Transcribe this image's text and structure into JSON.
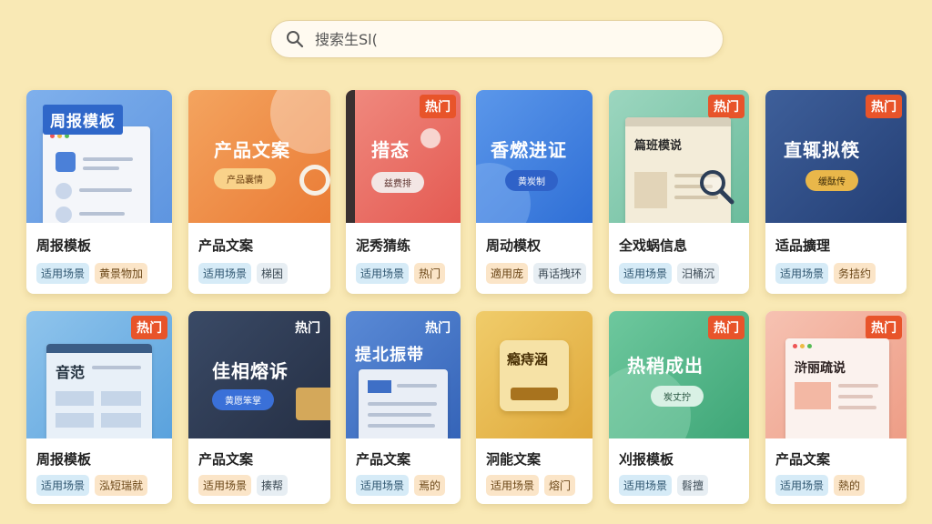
{
  "search": {
    "placeholder": "搜索生Sl("
  },
  "cards": [
    {
      "thumb_title": "周报模板",
      "hot": "",
      "pill": "",
      "name": "周报模板",
      "tags": [
        "适用场景",
        "黄景物加"
      ],
      "bg": "#5e95e0"
    },
    {
      "thumb_title": "产品文案",
      "hot": "",
      "pill": "产品囊情",
      "name": "产品文案",
      "tags": [
        "适用场景",
        "梯困"
      ],
      "bg": "#ef8c47"
    },
    {
      "thumb_title": "措态",
      "hot": "热门",
      "pill": "兹费排",
      "name": "泥秀猜练",
      "tags": [
        "适用场景",
        "热门"
      ],
      "bg": "#ea6a5f"
    },
    {
      "thumb_title": "香燃进证",
      "hot": "",
      "pill": "黄炭制",
      "name": "周动模权",
      "tags": [
        "適用庞",
        "再话拽环"
      ],
      "bg": "#3d7de0"
    },
    {
      "thumb_title": "篇班模说",
      "hot": "热门",
      "pill": "",
      "name": "全戏蜗信息",
      "tags": [
        "适用场景",
        "汨桶沉"
      ],
      "bg": "#7cc4a8"
    },
    {
      "thumb_title": "直辄拟筷",
      "hot": "热门",
      "pill": "缓酞传",
      "name": "适品擴理",
      "tags": [
        "适用场景",
        "务拮约"
      ],
      "bg": "#2f4f88"
    },
    {
      "thumb_title": "音范",
      "hot": "热门",
      "pill": "",
      "name": "周报模板",
      "tags": [
        "适用场景",
        "泓短瑞就"
      ],
      "bg": "#6aaee0"
    },
    {
      "thumb_title": "佳相熔诉",
      "hot": "热门",
      "pill": "黄愿笨掌",
      "name": "产品文案",
      "tags": [
        "适用场景",
        "揍帮"
      ],
      "bg": "#2e3d57"
    },
    {
      "thumb_title": "提北振带",
      "hot": "热门",
      "pill": "",
      "name": "产品文案",
      "tags": [
        "适用场景",
        "焉的"
      ],
      "bg": "#3f6fc4"
    },
    {
      "thumb_title": "瘾痔涵",
      "hot": "",
      "pill": "",
      "name": "泂能文案",
      "tags": [
        "适用场景",
        "熔门"
      ],
      "bg": "#e7b84a"
    },
    {
      "thumb_title": "热稍成出",
      "hot": "热门",
      "pill": "炭丈拧",
      "name": "刈报模板",
      "tags": [
        "适用场景",
        "髫擅"
      ],
      "bg": "#52b58a"
    },
    {
      "thumb_title": "浒丽疏说",
      "hot": "热门",
      "pill": "",
      "name": "产品文案",
      "tags": [
        "适用场景",
        "熱的"
      ],
      "bg": "#f0a896"
    }
  ]
}
